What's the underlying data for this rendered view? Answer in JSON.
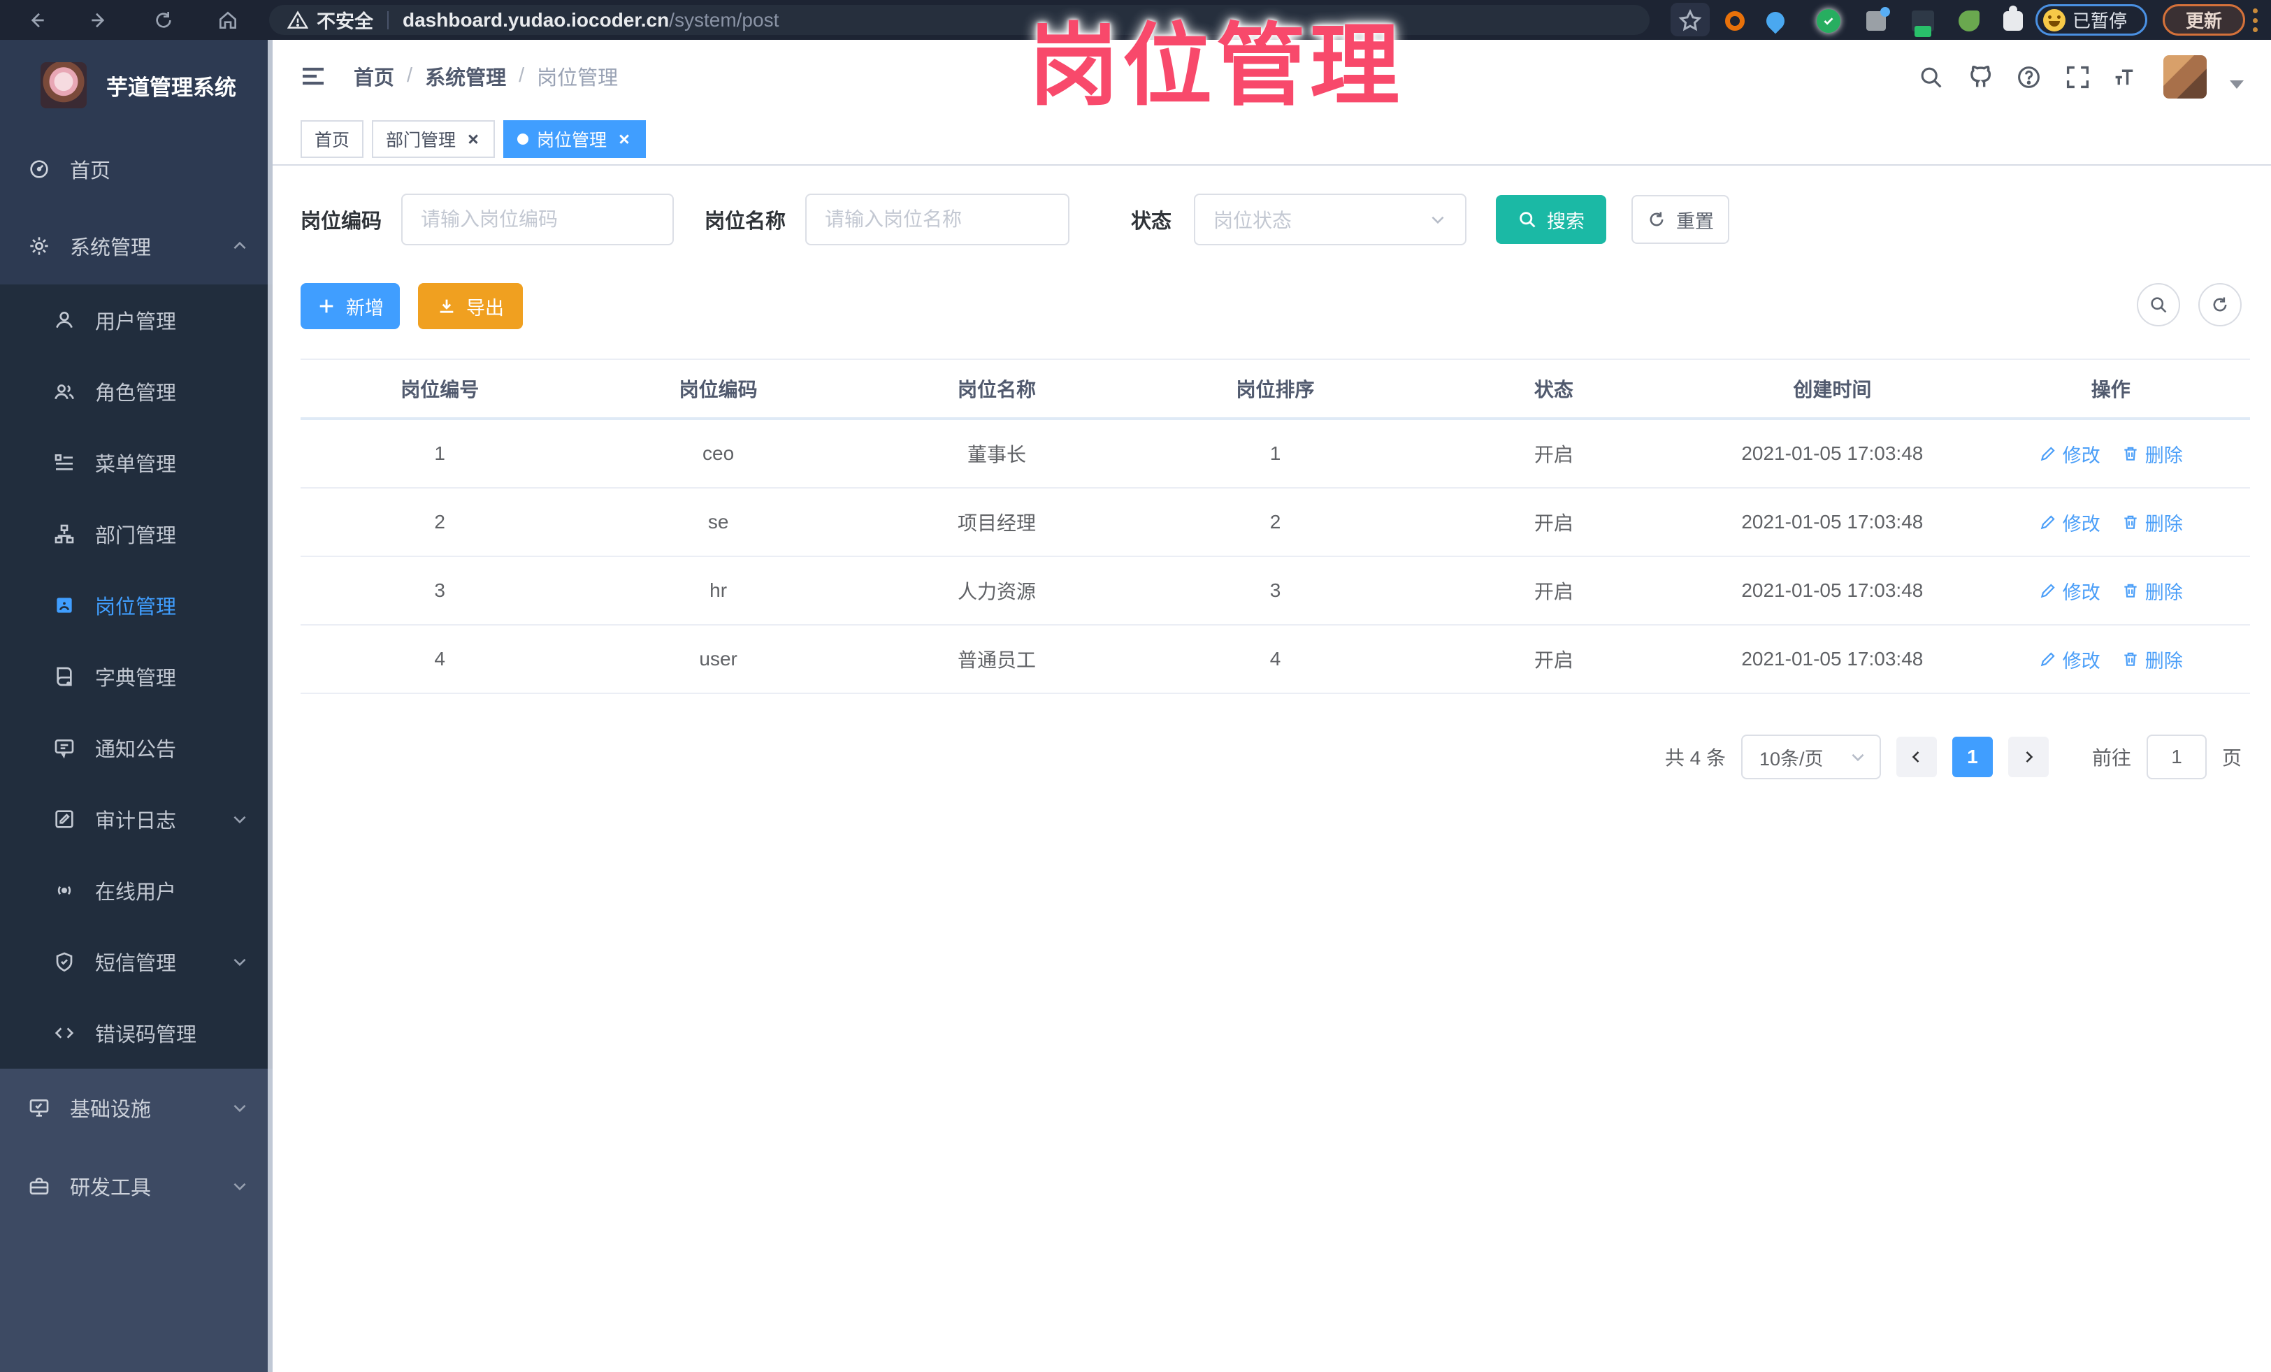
{
  "colors": {
    "accent": "#409eff",
    "search_button": "#1bb9a5",
    "export_button": "#f0a020",
    "overlay_title": "#f8496b",
    "sidebar_active": "#409eff"
  },
  "overlay_title": "岗位管理",
  "browser": {
    "security_label": "不安全",
    "url_host": "dashboard.yudao.iocoder.cn",
    "url_path": "/system/post",
    "paused_label": "已暂停",
    "update_label": "更新"
  },
  "sidebar": {
    "app_title": "芋道管理系统",
    "menu": [
      {
        "label": "首页",
        "icon": "dashboard-icon"
      },
      {
        "label": "系统管理",
        "icon": "gear-icon"
      },
      {
        "label": "用户管理",
        "icon": "user-icon"
      },
      {
        "label": "角色管理",
        "icon": "peoples-icon"
      },
      {
        "label": "菜单管理",
        "icon": "menu-list-icon"
      },
      {
        "label": "部门管理",
        "icon": "org-tree-icon"
      },
      {
        "label": "岗位管理",
        "icon": "post-icon",
        "active": true
      },
      {
        "label": "字典管理",
        "icon": "dict-icon"
      },
      {
        "label": "通知公告",
        "icon": "message-icon"
      },
      {
        "label": "审计日志",
        "icon": "log-icon"
      },
      {
        "label": "在线用户",
        "icon": "online-icon"
      },
      {
        "label": "短信管理",
        "icon": "shield-icon"
      },
      {
        "label": "错误码管理",
        "icon": "code-icon"
      },
      {
        "label": "基础设施",
        "icon": "monitor-icon"
      },
      {
        "label": "研发工具",
        "icon": "toolbox-icon"
      }
    ]
  },
  "header": {
    "breadcrumb": [
      "首页",
      "系统管理",
      "岗位管理"
    ],
    "separator": "/"
  },
  "tabs": [
    {
      "label": "首页"
    },
    {
      "label": "部门管理"
    },
    {
      "label": "岗位管理"
    }
  ],
  "filters": {
    "post_code_label": "岗位编码",
    "post_code_placeholder": "请输入岗位编码",
    "post_name_label": "岗位名称",
    "post_name_placeholder": "请输入岗位名称",
    "status_label": "状态",
    "status_placeholder": "岗位状态",
    "search_label": "搜索",
    "reset_label": "重置"
  },
  "toolbar": {
    "add_label": "新增",
    "export_label": "导出"
  },
  "table": {
    "columns": [
      "岗位编号",
      "岗位编码",
      "岗位名称",
      "岗位排序",
      "状态",
      "创建时间",
      "操作"
    ],
    "action_edit": "修改",
    "action_delete": "删除",
    "rows": [
      {
        "id": "1",
        "code": "ceo",
        "name": "董事长",
        "sort": "1",
        "status": "开启",
        "created": "2021-01-05 17:03:48"
      },
      {
        "id": "2",
        "code": "se",
        "name": "项目经理",
        "sort": "2",
        "status": "开启",
        "created": "2021-01-05 17:03:48"
      },
      {
        "id": "3",
        "code": "hr",
        "name": "人力资源",
        "sort": "3",
        "status": "开启",
        "created": "2021-01-05 17:03:48"
      },
      {
        "id": "4",
        "code": "user",
        "name": "普通员工",
        "sort": "4",
        "status": "开启",
        "created": "2021-01-05 17:03:48"
      }
    ]
  },
  "pagination": {
    "total_label": "共 4 条",
    "page_size": "10条/页",
    "current_page": "1",
    "goto_label": "前往",
    "goto_value": "1",
    "page_unit": "页"
  }
}
